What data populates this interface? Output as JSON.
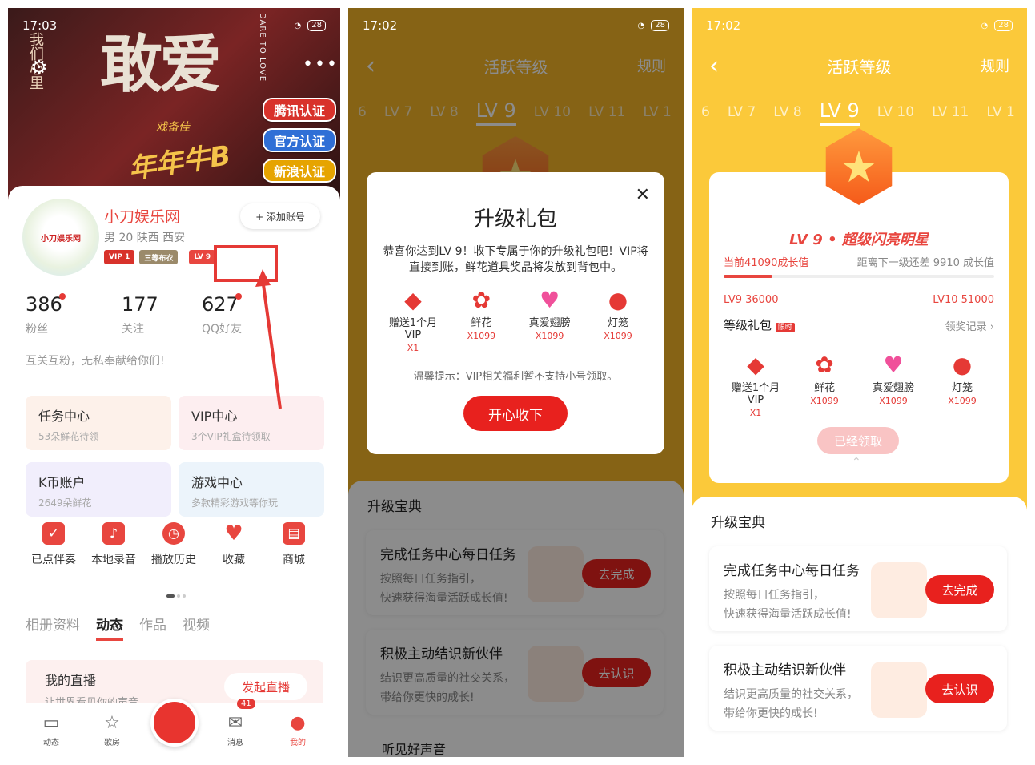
{
  "panel1": {
    "status": {
      "time": "17:03",
      "battery": "28"
    },
    "cover": {
      "big": "敢爱",
      "side": "我们心里",
      "dtl": "DARE TO LOVE",
      "sign": "年年牛B",
      "sign2": "戏备佳",
      "cert": [
        "腾讯认证",
        "官方认证",
        "新浪认证"
      ]
    },
    "profile": {
      "nick": "小刀娱乐网",
      "info": "男 20 陕西 西安",
      "add": "+ 添加账号",
      "badges": [
        "VIP 1",
        "三等布衣",
        "LV 9"
      ],
      "avatar": "小刀娱乐网"
    },
    "stats": [
      {
        "n": "386",
        "l": "粉丝"
      },
      {
        "n": "177",
        "l": "关注"
      },
      {
        "n": "627",
        "l": "QQ好友"
      }
    ],
    "bio": "互关互粉，无私奉献给你们!",
    "tiles": [
      {
        "t": "任务中心",
        "s": "53朵鲜花待领"
      },
      {
        "t": "VIP中心",
        "s": "3个VIP礼盒待领取"
      },
      {
        "t": "K币账户",
        "s": "2649朵鲜花"
      },
      {
        "t": "游戏中心",
        "s": "多款精彩游戏等你玩"
      }
    ],
    "icons": [
      "已点伴奏",
      "本地录音",
      "播放历史",
      "收藏",
      "商城"
    ],
    "tabs": [
      "相册资料",
      "动态",
      "作品",
      "视频"
    ],
    "live": {
      "t": "我的直播",
      "s": "让世界看见你的声音",
      "b": "发起直播"
    },
    "nav": [
      "动态",
      "歌房",
      "消息",
      "我的"
    ],
    "msg_count": "41"
  },
  "panel2": {
    "status": {
      "time": "17:02",
      "battery": "28"
    },
    "title": "活跃等级",
    "rule": "规则",
    "levels": [
      "6",
      "LV 7",
      "LV 8",
      "LV 9",
      "LV 10",
      "LV 11",
      "LV 1"
    ],
    "modal": {
      "h": "升级礼包",
      "p": "恭喜你达到LV 9！收下专属于你的升级礼包吧！VIP将直接到账，鲜花道具奖品将发放到背包中。",
      "tip": "温馨提示：VIP相关福利暂不支持小号领取。",
      "btn": "开心收下",
      "gifts": [
        {
          "n": "赠送1个月VIP",
          "q": "X1"
        },
        {
          "n": "鲜花",
          "q": "X1099"
        },
        {
          "n": "真爱翅膀",
          "q": "X1099"
        },
        {
          "n": "灯笼",
          "q": "X1099"
        }
      ]
    },
    "sheet_h": "升级宝典",
    "tasks": [
      {
        "t": "完成任务中心每日任务",
        "s1": "按照每日任务指引，",
        "s2": "快速获得海量活跃成长值!",
        "b": "去完成"
      },
      {
        "t": "积极主动结识新伙伴",
        "s1": "结识更高质量的社交关系，",
        "s2": "带给你更快的成长!",
        "b": "去认识"
      }
    ],
    "peek": "听见好声音"
  },
  "panel3": {
    "status": {
      "time": "17:02",
      "battery": "28"
    },
    "title": "活跃等级",
    "rule": "规则",
    "levels": [
      "6",
      "LV 7",
      "LV 8",
      "LV 9",
      "LV 10",
      "LV 11",
      "LV 1"
    ],
    "card": {
      "title": "LV 9 • 超级闪亮明星",
      "cur": "当前41090成长值",
      "next": "距离下一级还差 9910 成长值",
      "progress": 0.18,
      "l1": "LV9 36000",
      "l2": "LV10 51000",
      "pack": "等级礼包",
      "tag": "限时",
      "rec": "领奖记录 ›",
      "btn": "已经领取",
      "gifts": [
        {
          "n": "赠送1个月VIP",
          "q": "X1"
        },
        {
          "n": "鲜花",
          "q": "X1099"
        },
        {
          "n": "真爱翅膀",
          "q": "X1099"
        },
        {
          "n": "灯笼",
          "q": "X1099"
        }
      ]
    },
    "sheet_h": "升级宝典",
    "tasks": [
      {
        "t": "完成任务中心每日任务",
        "s1": "按照每日任务指引，",
        "s2": "快速获得海量活跃成长值!",
        "b": "去完成"
      },
      {
        "t": "积极主动结识新伙伴",
        "s1": "结识更高质量的社交关系，",
        "s2": "带给你更快的成长!",
        "b": "去认识"
      }
    ]
  }
}
